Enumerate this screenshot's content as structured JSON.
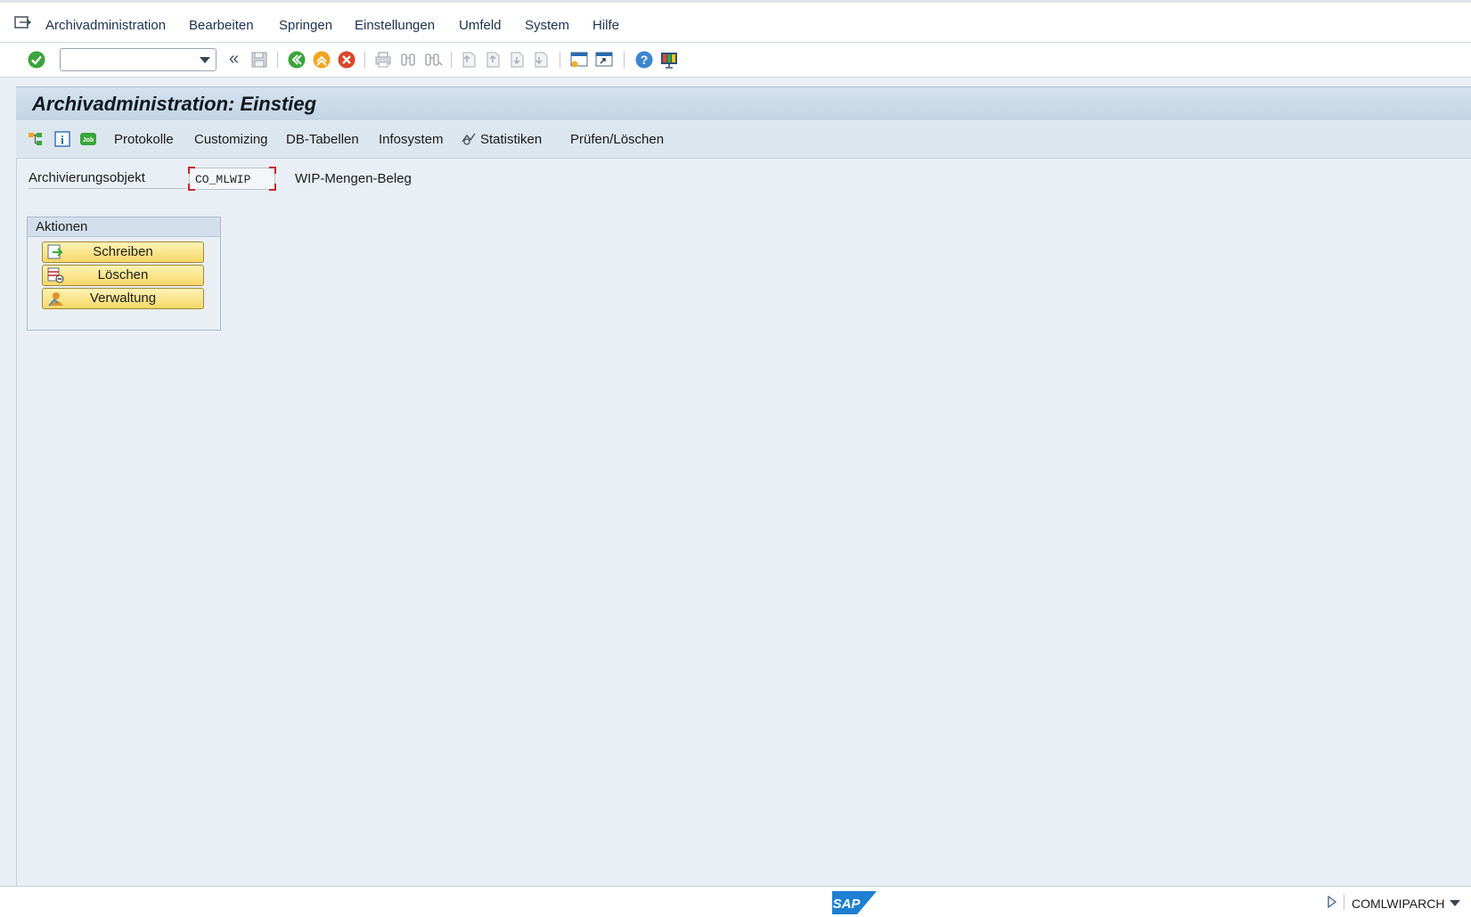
{
  "menu": {
    "items": [
      {
        "label": "Archivadministration"
      },
      {
        "label": "Bearbeiten"
      },
      {
        "label": "Springen"
      },
      {
        "label": "Einstellungen"
      },
      {
        "label": "Umfeld"
      },
      {
        "label": "System"
      },
      {
        "label": "Hilfe"
      }
    ]
  },
  "toolbar": {
    "command_value": "",
    "icons": [
      "enter-icon",
      "back-double-icon",
      "save-icon",
      "back-icon",
      "exit-icon",
      "cancel-icon",
      "print-icon",
      "find-icon",
      "find-next-icon",
      "first-page-icon",
      "previous-page-icon",
      "next-page-icon",
      "last-page-icon",
      "create-session-icon",
      "shortcut-icon",
      "help-icon",
      "customize-layout-icon"
    ]
  },
  "title": {
    "text": "Archivadministration: Einstieg"
  },
  "app_toolbar": {
    "items": [
      {
        "label": "Protokolle"
      },
      {
        "label": "Customizing"
      },
      {
        "label": "DB-Tabellen"
      },
      {
        "label": "Infosystem"
      },
      {
        "label": "Statistiken"
      },
      {
        "label": "Prüfen/Löschen"
      }
    ]
  },
  "form": {
    "object_label": "Archivierungsobjekt",
    "object_value": "CO_MLWIP",
    "object_description": "WIP-Mengen-Beleg"
  },
  "actions": {
    "title": "Aktionen",
    "buttons": [
      {
        "label": "Schreiben"
      },
      {
        "label": "Löschen"
      },
      {
        "label": "Verwaltung"
      }
    ]
  },
  "status": {
    "logo": "SAP",
    "system": "COMLWIPARCH"
  },
  "colors": {
    "background": "#e9eff5",
    "title_bar": "#c3d4e4",
    "action_button": "#f6d868",
    "ok_green": "#3aa53a",
    "sap_blue": "#1f7fd0"
  }
}
